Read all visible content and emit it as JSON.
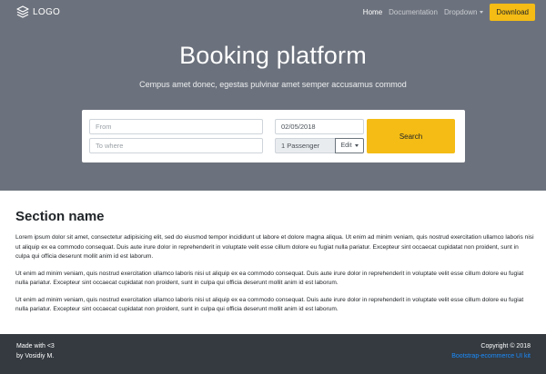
{
  "navbar": {
    "logo_text": "LOGO",
    "links": [
      "Home",
      "Documentation",
      "Dropdown"
    ],
    "download_label": "Download"
  },
  "hero": {
    "title": "Booking platform",
    "subtitle": "Cempus amet donec, egestas pulvinar amet semper accusamus commod"
  },
  "search": {
    "from_placeholder": "From",
    "to_placeholder": "To where",
    "date_value": "02/05/2018",
    "passengers_value": "1 Passenger",
    "edit_label": "Edit",
    "search_label": "Search"
  },
  "section": {
    "title": "Section name",
    "paragraphs": [
      "Lorem ipsum dolor sit amet, consectetur adipisicing elit, sed do eiusmod tempor incididunt ut labore et dolore magna aliqua. Ut enim ad minim veniam, quis nostrud exercitation ullamco laboris nisi ut aliquip ex ea commodo consequat. Duis aute irure dolor in reprehenderit in voluptate velit esse cillum dolore eu fugiat nulla pariatur. Excepteur sint occaecat cupidatat non proident, sunt in culpa qui officia deserunt mollit anim id est laborum.",
      "Ut enim ad minim veniam, quis nostrud exercitation ullamco laboris nisi ut aliquip ex ea commodo consequat. Duis aute irure dolor in reprehenderit in voluptate velit esse cillum dolore eu fugiat nulla pariatur. Excepteur sint occaecat cupidatat non proident, sunt in culpa qui officia deserunt mollit anim id est laborum.",
      "Ut enim ad minim veniam, quis nostrud exercitation ullamco laboris nisi ut aliquip ex ea commodo consequat. Duis aute irure dolor in reprehenderit in voluptate velit esse cillum dolore eu fugiat nulla pariatur. Excepteur sint occaecat cupidatat non proident, sunt in culpa qui officia deserunt mollit anim id est laborum."
    ]
  },
  "footer": {
    "made_with": "Made with <3",
    "author": "by Vosidiy M.",
    "copyright": "Copyright © 2018",
    "link_text": "Bootstrap-ecommerce UI kit"
  },
  "colors": {
    "hero_bg": "#6c727d",
    "accent": "#f4bc14",
    "footer_bg": "#343a40",
    "link": "#1a8cff"
  },
  "icons": [
    "logo-icon",
    "dropdown-caret-icon",
    "edit-caret-icon"
  ]
}
